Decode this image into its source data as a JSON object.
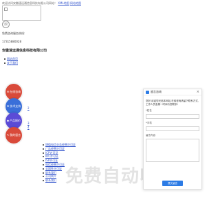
{
  "topbar": {
    "welcome": "欢迎访问安徽速运通信息科技有限公司网站！",
    "links": [
      "XML地图",
      "网站地图"
    ]
  },
  "logo": {
    "alt": ""
  },
  "hotline": {
    "label": "免费咨询服务热线:",
    "number": "17315880028"
  },
  "company_name": "安徽速运通信息科技有限公司",
  "nav": {
    "items": [
      "网站首页",
      "关于我们"
    ]
  },
  "side_buttons": [
    "在线咨询",
    "技术支持",
    "产品报价",
    "我的留言"
  ],
  "side_texts": [
    "2",
    "3",
    "4"
  ],
  "lower_links": [
    "增值电信业务经营许可证",
    "广告经营许可证",
    "ICP许可证",
    "IDC许可证",
    "ISP许可证",
    "电信经营许可证",
    "全国性许可证",
    "联系我们",
    "公司简介",
    "联系我们"
  ],
  "watermark": "免费自动收录",
  "chat": {
    "title": "留言咨询",
    "message": "您好,欢迎您光临本网站,在线咨询请留下联系方式,工作人员会第一时间与您联系!",
    "fields": [
      "*姓名",
      "*手机"
    ],
    "textarea_label": "留言内容",
    "submit_label": "提交留言"
  }
}
